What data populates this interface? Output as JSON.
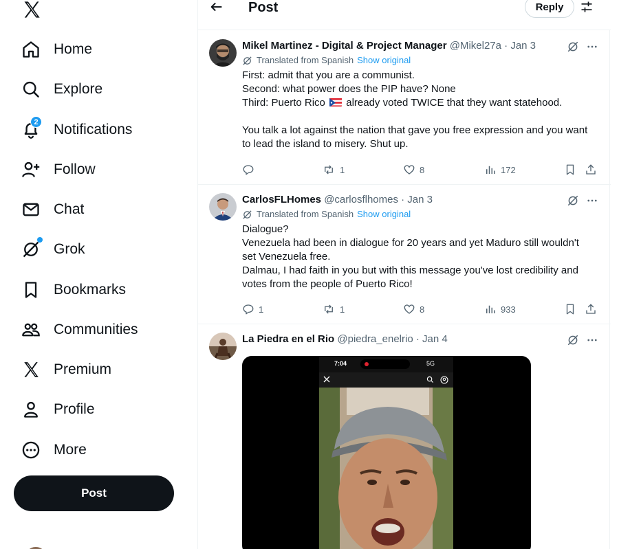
{
  "sidebar": {
    "nav": [
      {
        "label": "Home",
        "icon": "home-icon"
      },
      {
        "label": "Explore",
        "icon": "search-icon"
      },
      {
        "label": "Notifications",
        "icon": "bell-icon",
        "badge": "2"
      },
      {
        "label": "Follow",
        "icon": "add-person-icon"
      },
      {
        "label": "Chat",
        "icon": "envelope-icon"
      },
      {
        "label": "Grok",
        "icon": "grok-icon"
      },
      {
        "label": "Bookmarks",
        "icon": "bookmark-icon"
      },
      {
        "label": "Communities",
        "icon": "communities-icon"
      },
      {
        "label": "Premium",
        "icon": "x-logo-icon"
      },
      {
        "label": "Profile",
        "icon": "person-icon"
      },
      {
        "label": "More",
        "icon": "more-circle-icon"
      }
    ],
    "post_label": "Post"
  },
  "header": {
    "title": "Post",
    "reply_label": "Reply"
  },
  "tweets": [
    {
      "name": "Mikel Martinez - Digital & Project Manager",
      "handle": "@Mikel27a",
      "date": "· Jan 3",
      "translated": "Translated from Spanish",
      "show_original": "Show original",
      "lines": [
        "First: admit that you are a communist.",
        "Second: what power does the PIP have? None",
        "",
        "",
        "You talk a lot against the nation that gave you free expression and you want",
        "to lead the island to misery. Shut up."
      ],
      "line3_before": "Third: Puerto Rico",
      "line3_after": "already voted TWICE that they want statehood.",
      "replies": "",
      "reposts": "1",
      "likes": "8",
      "views": "172"
    },
    {
      "name": "CarlosFLHomes",
      "handle": "@carlosflhomes",
      "date": "· Jan 3",
      "translated": "Translated from Spanish",
      "show_original": "Show original",
      "lines": [
        "Dialogue?",
        "Venezuela had been in dialogue for 20 years and yet Maduro still wouldn't",
        "set Venezuela free.",
        "Dalmau, I had faith in you but with this message you've lost credibility and",
        "votes from the people of Puerto Rico!"
      ],
      "replies": "1",
      "reposts": "1",
      "likes": "8",
      "views": "933"
    },
    {
      "name": "La Piedra en el Rio",
      "handle": "@piedra_enelrio",
      "date": "· Jan 4",
      "phone_time": "7:04",
      "phone_net": "5G"
    }
  ],
  "colors": {
    "accent": "#1d9bf0",
    "text": "#0f1419",
    "muted": "#536471",
    "border": "#eff3f4"
  }
}
